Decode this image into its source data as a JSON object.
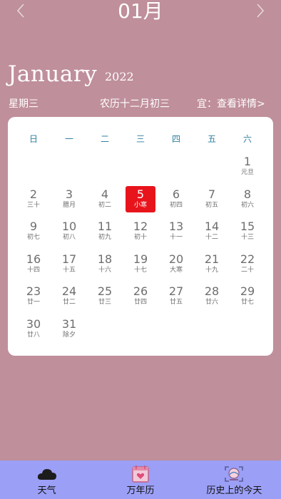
{
  "header": {
    "month_title": "01月",
    "prev_icon": "chevron-left-icon",
    "next_icon": "chevron-right-icon",
    "english_month": "January",
    "year": "2022",
    "weekday": "星期三",
    "lunar_date": "农历十二月初三",
    "yi_text": "宜：查看详情>"
  },
  "calendar": {
    "week_headers": [
      "日",
      "一",
      "二",
      "三",
      "四",
      "五",
      "六"
    ],
    "today_color": "#e8141c",
    "first_weekday_index": 6,
    "days": [
      {
        "day": "1",
        "lunar": "元旦"
      },
      {
        "day": "2",
        "lunar": "三十"
      },
      {
        "day": "3",
        "lunar": "腊月"
      },
      {
        "day": "4",
        "lunar": "初二"
      },
      {
        "day": "5",
        "lunar": "小寒",
        "today": true
      },
      {
        "day": "6",
        "lunar": "初四"
      },
      {
        "day": "7",
        "lunar": "初五"
      },
      {
        "day": "8",
        "lunar": "初六"
      },
      {
        "day": "9",
        "lunar": "初七"
      },
      {
        "day": "10",
        "lunar": "初八"
      },
      {
        "day": "11",
        "lunar": "初九"
      },
      {
        "day": "12",
        "lunar": "初十"
      },
      {
        "day": "13",
        "lunar": "十一"
      },
      {
        "day": "14",
        "lunar": "十二"
      },
      {
        "day": "15",
        "lunar": "十三"
      },
      {
        "day": "16",
        "lunar": "十四"
      },
      {
        "day": "17",
        "lunar": "十五"
      },
      {
        "day": "18",
        "lunar": "十六"
      },
      {
        "day": "19",
        "lunar": "十七"
      },
      {
        "day": "20",
        "lunar": "大寒"
      },
      {
        "day": "21",
        "lunar": "十九"
      },
      {
        "day": "22",
        "lunar": "二十"
      },
      {
        "day": "23",
        "lunar": "廿一"
      },
      {
        "day": "24",
        "lunar": "廿二"
      },
      {
        "day": "25",
        "lunar": "廿三"
      },
      {
        "day": "26",
        "lunar": "廿四"
      },
      {
        "day": "27",
        "lunar": "廿五"
      },
      {
        "day": "28",
        "lunar": "廿六"
      },
      {
        "day": "29",
        "lunar": "廿七"
      },
      {
        "day": "30",
        "lunar": "廿八"
      },
      {
        "day": "31",
        "lunar": "除夕"
      }
    ]
  },
  "tabbar": {
    "background": "#9b9ff5",
    "tabs": [
      {
        "label": "天气",
        "icon": "cloud-icon"
      },
      {
        "label": "万年历",
        "icon": "calendar-icon"
      },
      {
        "label": "历史上的今天",
        "icon": "history-icon"
      }
    ]
  }
}
